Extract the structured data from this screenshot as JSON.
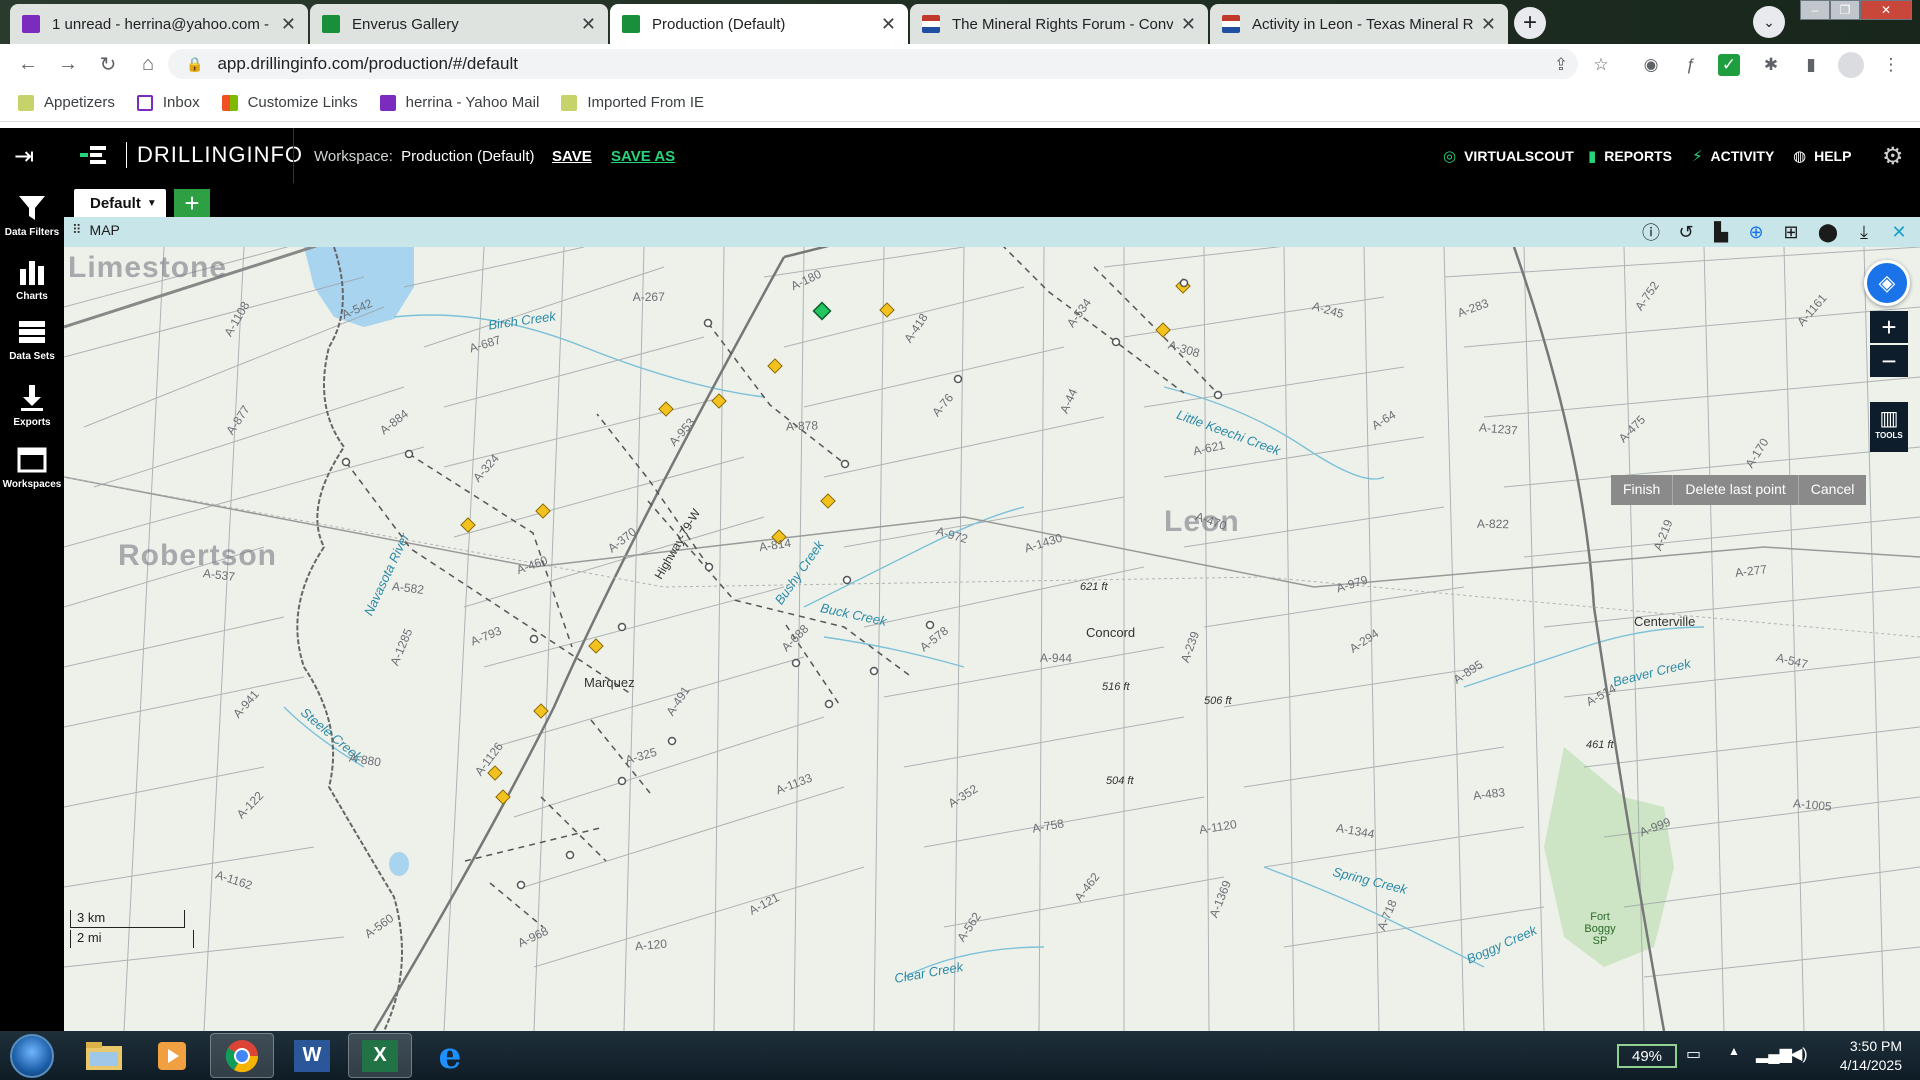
{
  "browser": {
    "tabs": [
      {
        "title": "1 unread - herrina@yahoo.com -",
        "icon": "yahoo-mail-icon",
        "color": "#7b2cbf"
      },
      {
        "title": "Enverus Gallery",
        "icon": "enverus-icon",
        "color": "#1a8f3a"
      },
      {
        "title": "Production (Default)",
        "icon": "enverus-icon",
        "color": "#1a8f3a",
        "active": true
      },
      {
        "title": "The Mineral Rights Forum - Conv",
        "icon": "forum-flag-icon",
        "color": "#c0392b"
      },
      {
        "title": "Activity in Leon - Texas Mineral R",
        "icon": "forum-flag-icon",
        "color": "#c0392b"
      }
    ],
    "url": "app.drillinginfo.com/production/#/default",
    "bookmarks": [
      "Appetizers",
      "Inbox",
      "Customize Links",
      "herrina - Yahoo Mail",
      "Imported From IE"
    ]
  },
  "app": {
    "brand": "DRILLINGINFO",
    "workspace_label": "Workspace:",
    "workspace_name": "Production (Default)",
    "save": "SAVE",
    "save_as": "SAVE AS",
    "nav": {
      "virtual_scout": "VIRTUALSCOUT",
      "reports": "REPORTS",
      "activity": "ACTIVITY",
      "help": "HELP"
    },
    "sidebar": [
      "Data Filters",
      "Charts",
      "Data Sets",
      "Exports",
      "Workspaces"
    ],
    "workspace_tab": "Default",
    "map_label": "MAP",
    "draw_actions": [
      "Finish",
      "Delete last point",
      "Cancel"
    ],
    "tools_label": "TOOLS",
    "scale": {
      "km": "3 km",
      "mi": "2 mi"
    },
    "accent": "#28d47a"
  },
  "map": {
    "counties": [
      "Limestone",
      "Robertson",
      "Leon"
    ],
    "towns": [
      "Marquez",
      "Concord",
      "Centerville",
      "Fort Boggy SP"
    ],
    "creeks": [
      "Birch Creek",
      "Little Keechi Creek",
      "Bushy Creek",
      "Buck Creek",
      "Navasota River",
      "Steele Creek",
      "Beaver Creek",
      "Spring Creek",
      "Boggy Creek",
      "Clear Creek"
    ],
    "roads": [
      "Highway-79-W"
    ],
    "elevations": [
      "621 ft",
      "461 ft",
      "504 ft",
      "506 ft",
      "516 ft"
    ],
    "abstracts": [
      "A-1108",
      "A-542",
      "A-687",
      "A-267",
      "A-180",
      "A-418",
      "A-534",
      "A-308",
      "A-245",
      "A-283",
      "A-752",
      "A-1161",
      "A-877",
      "A-884",
      "A-324",
      "A-953",
      "A-878",
      "A-76",
      "A-44",
      "A-621",
      "A-64",
      "A-1237",
      "A-475",
      "A-170",
      "A-537",
      "A-582",
      "A-460",
      "A-370",
      "A-814",
      "A-972",
      "A-1430",
      "A-470",
      "A-979",
      "A-822",
      "A-219",
      "A-277",
      "A-941",
      "A-1285",
      "A-793",
      "A-491",
      "A-688",
      "A-578",
      "A-944",
      "A-239",
      "A-294",
      "A-895",
      "A-514",
      "A-547",
      "A-122",
      "A-880",
      "A-1126",
      "A-325",
      "A-1133",
      "A-352",
      "A-758",
      "A-1120",
      "A-1344",
      "A-483",
      "A-999",
      "A-1005",
      "A-1162",
      "A-560",
      "A-968",
      "A-120",
      "A-121",
      "A-562",
      "A-462",
      "A-1369",
      "A-718"
    ]
  },
  "taskbar": {
    "battery": "49%",
    "time": "3:50 PM",
    "date": "4/14/2025"
  }
}
